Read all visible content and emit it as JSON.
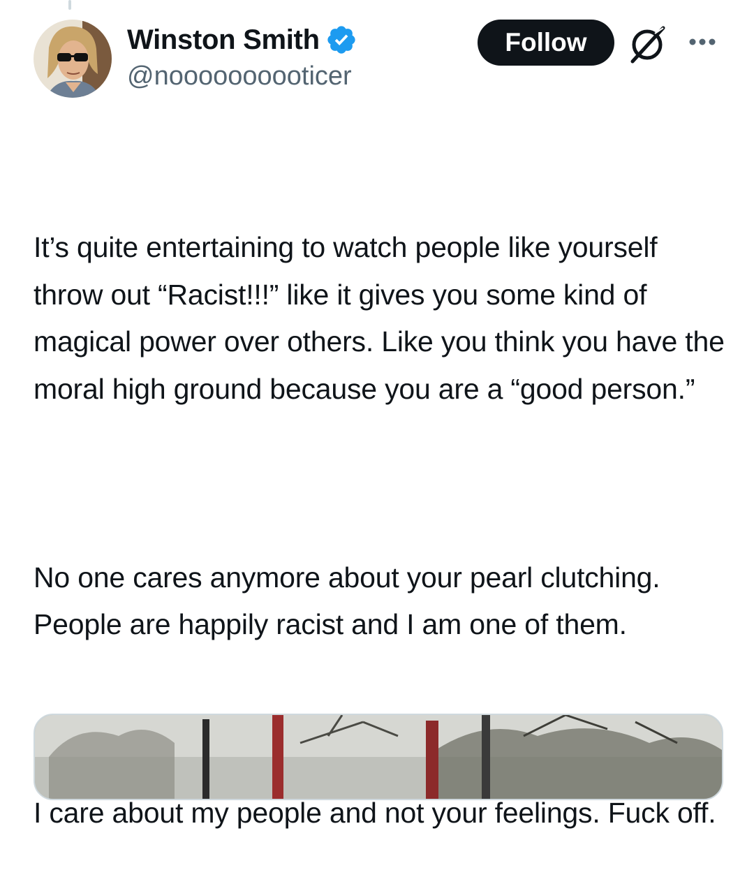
{
  "author": {
    "display_name": "Winston Smith",
    "handle": "@noooooooooticer",
    "verified": true,
    "verified_color": "#1d9bf0"
  },
  "actions": {
    "follow_label": "Follow",
    "grok_icon": "grok-icon",
    "more_icon": "more-options-icon"
  },
  "tweet": {
    "paragraphs": [
      "It’s quite entertaining to watch people like yourself throw out “Racist!!!” like it gives you some kind of magical power over others. Like you think you have the moral high ground because you are a “good person.”",
      "No one cares anymore about your pearl clutching. People are happily racist and I am one of them.",
      "I care about my people and not your feelings. Fuck off."
    ]
  },
  "colors": {
    "text": "#0f1419",
    "secondary_text": "#536471",
    "follow_bg": "#0f1419",
    "follow_text": "#ffffff"
  }
}
